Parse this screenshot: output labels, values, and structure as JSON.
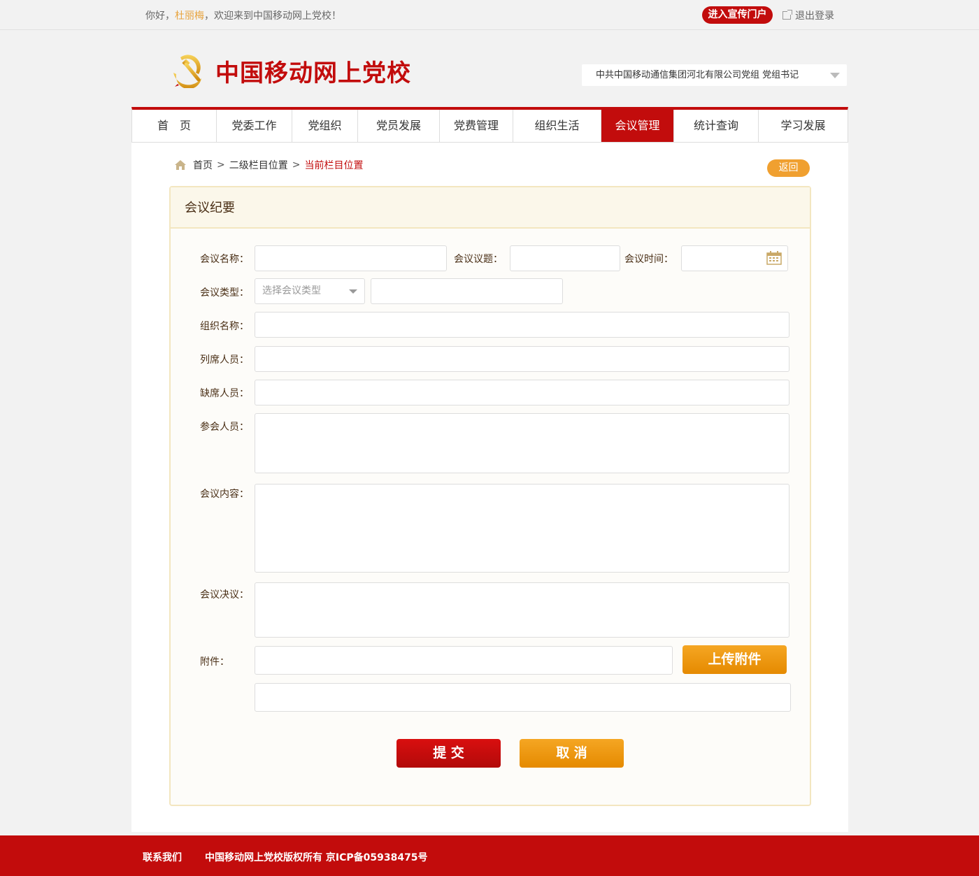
{
  "topbar": {
    "greeting_prefix": "你好，",
    "user_name": "杜丽梅",
    "greeting_suffix": "，欢迎来到中国移动网上党校！",
    "portal_button": "进入宣传门户",
    "logout": "退出登录"
  },
  "header": {
    "site_title": "中国移动网上党校",
    "org_select": "中共中国移动通信集团河北有限公司党组   党组书记"
  },
  "nav": {
    "items": [
      {
        "label": "首　页"
      },
      {
        "label": "党委工作"
      },
      {
        "label": "党组织"
      },
      {
        "label": "党员发展"
      },
      {
        "label": "党费管理"
      },
      {
        "label": "组织生活"
      },
      {
        "label": "会议管理",
        "active": true
      },
      {
        "label": "统计查询"
      },
      {
        "label": "学习发展"
      }
    ]
  },
  "breadcrumb": {
    "home": "首页",
    "level2": "二级栏目位置",
    "current": "当前栏目位置",
    "separator": ">"
  },
  "back_button": "返回",
  "form": {
    "title": "会议纪要",
    "labels": {
      "meeting_name": "会议名称：",
      "meeting_topic": "会议议题：",
      "meeting_time": "会议时间：",
      "meeting_type": "会议类型：",
      "org_name": "组织名称：",
      "attendees_present": "列席人员：",
      "absentees": "缺席人员：",
      "participants": "参会人员：",
      "content": "会议内容：",
      "resolution": "会议决议：",
      "attachment": "附件："
    },
    "type_placeholder": "选择会议类型",
    "upload_button": "上传附件",
    "submit_button": "提 交",
    "cancel_button": "取 消"
  },
  "footer": {
    "contact": "联系我们",
    "copyright": "中国移动网上党校版权所有  京ICP备05938475号"
  },
  "colors": {
    "brand_red": "#c20c0c",
    "accent_orange": "#f0a030",
    "username_gold": "#e8a33c"
  }
}
